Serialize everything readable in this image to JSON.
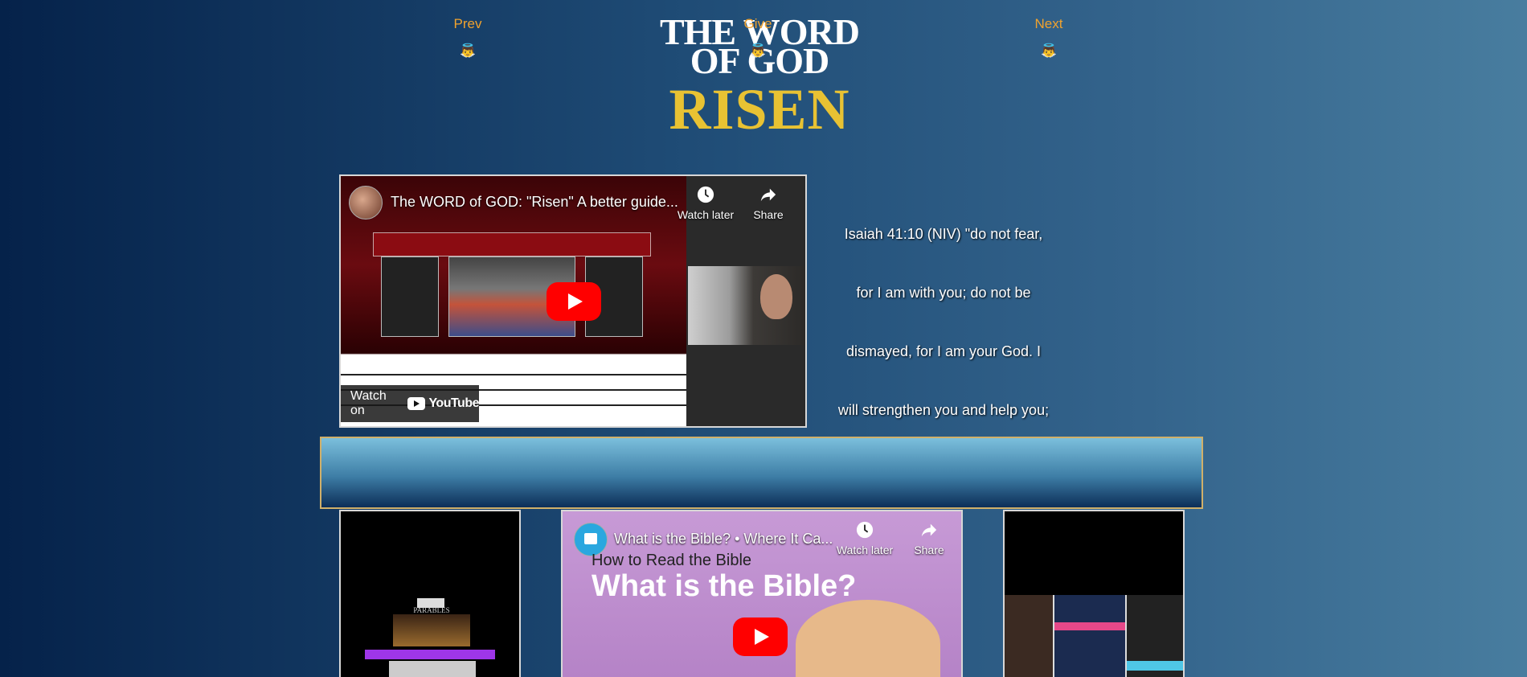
{
  "brand": {
    "line1": "THE WORD",
    "line2": "OF GOD",
    "line3": "RISEN",
    "accent_color": "#e8c233"
  },
  "video_main": {
    "title": "The WORD of GOD: \"Risen\" A better guide...",
    "watch_later": "Watch later",
    "share": "Share",
    "watch_on": "Watch on",
    "youtube": "YouTube"
  },
  "verse": {
    "lines": [
      "Isaiah 41:10 (NIV) \"do not fear,",
      "for I am with you; do not be",
      "dismayed, for I am your God. I",
      "will strengthen you and help you;"
    ]
  },
  "nav": {
    "prev": "Prev",
    "give": "Give",
    "next": "Next",
    "label_color": "#f0a22e"
  },
  "video_second": {
    "title": "What is the Bible? • Where It Ca...",
    "watch_later": "Watch later",
    "share": "Share",
    "subtitle": "How to Read the Bible",
    "headline": "What is the Bible?"
  },
  "thumb_left": {
    "title": "PARABLES"
  }
}
